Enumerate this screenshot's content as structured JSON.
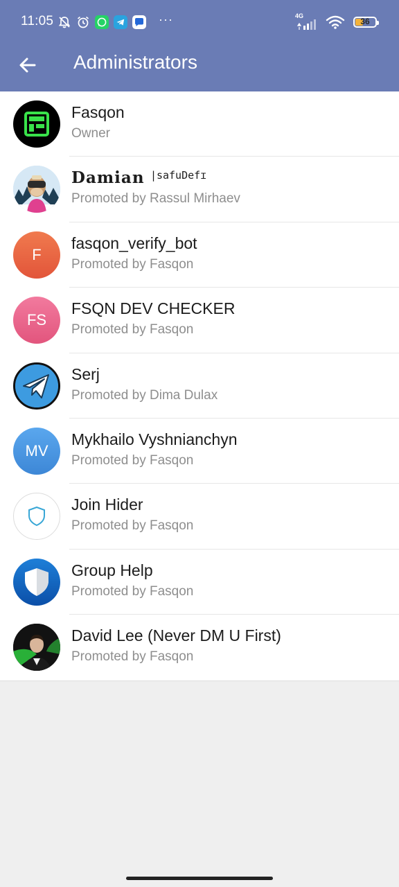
{
  "status_bar": {
    "time": "11:05",
    "network": "4G",
    "battery_level": "36",
    "battery_percent": 36,
    "more": "···"
  },
  "app_bar": {
    "title": "Administrators",
    "back_icon": "arrow-left-icon"
  },
  "colors": {
    "header": "#6a7cb5",
    "avatar_orange": "#e9673f",
    "avatar_pink": "#e8648a",
    "avatar_blue": "#4a90d9"
  },
  "admins": [
    {
      "name": "Fasqon",
      "subtitle": "Owner",
      "avatar_icon": "fasqon-logo"
    },
    {
      "name": "Damian",
      "name_tag": "|safuDefɪ",
      "subtitle": "Promoted by Rassul Mirhaev",
      "avatar_icon": "ape-avatar"
    },
    {
      "name": "fasqon_verify_bot",
      "subtitle": "Promoted by Fasqon",
      "avatar_initials": "F"
    },
    {
      "name": "FSQN DEV CHECKER",
      "subtitle": "Promoted by Fasqon",
      "avatar_initials": "FS"
    },
    {
      "name": "Serj",
      "subtitle": "Promoted by Dima Dulax",
      "avatar_icon": "paper-plane-icon"
    },
    {
      "name": "Mykhailo Vyshnianchyn",
      "subtitle": "Promoted by Fasqon",
      "avatar_initials": "MV"
    },
    {
      "name": "Join Hider",
      "subtitle": "Promoted by Fasqon",
      "avatar_icon": "shield-outline-icon"
    },
    {
      "name": "Group Help",
      "subtitle": "Promoted by Fasqon",
      "avatar_icon": "shield-icon"
    },
    {
      "name": "David Lee (Never DM U First)",
      "subtitle": "Promoted by Fasqon",
      "avatar_icon": "person-photo"
    }
  ]
}
